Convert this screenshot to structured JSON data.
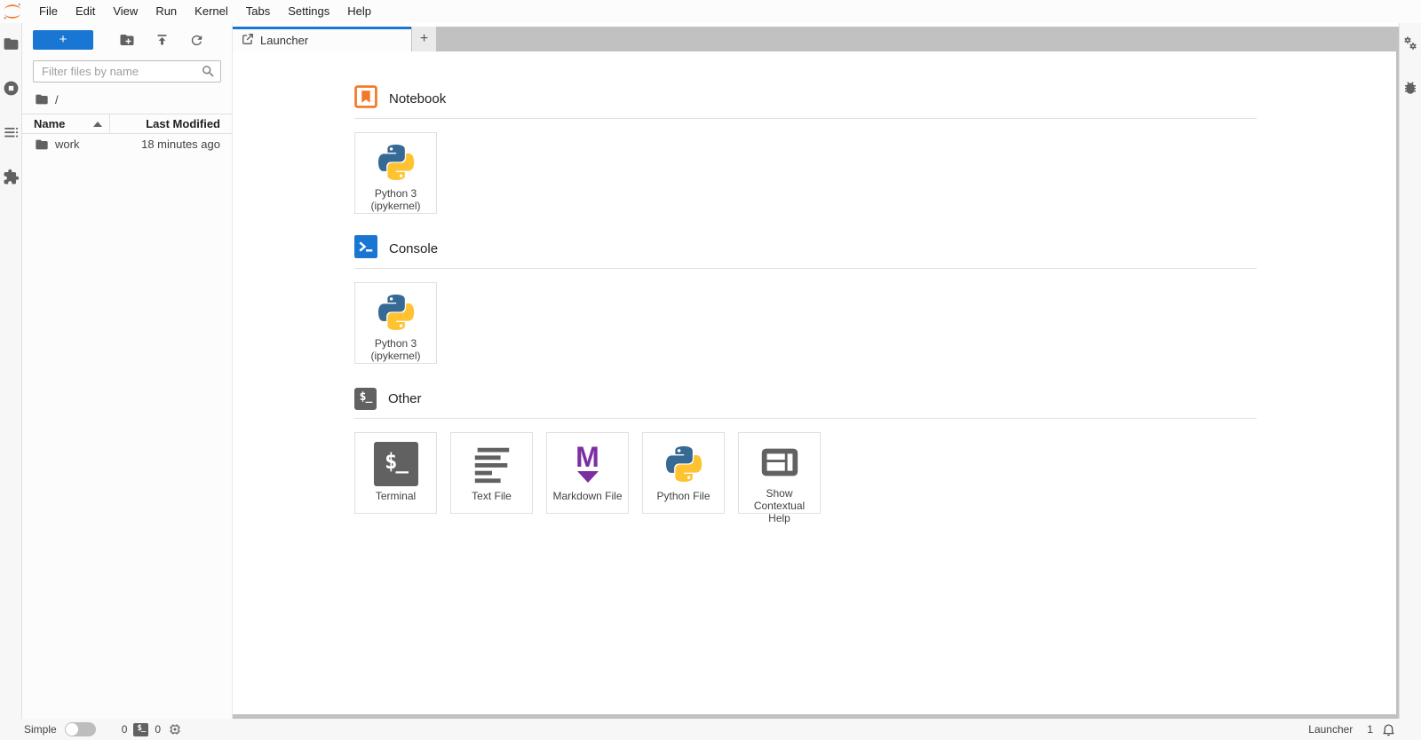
{
  "menu_bar": {
    "items": [
      "File",
      "Edit",
      "View",
      "Run",
      "Kernel",
      "Tabs",
      "Settings",
      "Help"
    ]
  },
  "left_sidebar": {
    "icons": [
      "file-browser",
      "running-terminals-and-kernels",
      "table-of-contents",
      "extension-manager"
    ]
  },
  "right_sidebar": {
    "icons": [
      "property-inspector",
      "debugger"
    ]
  },
  "file_browser": {
    "filter_placeholder": "Filter files by name",
    "breadcrumb_root": "/",
    "columns": [
      {
        "label": "Name"
      },
      {
        "label": "Last Modified"
      }
    ],
    "rows": [
      {
        "name": "work",
        "type": "folder",
        "last_modified": "18 minutes ago"
      }
    ]
  },
  "tab_bar": {
    "tabs": [
      {
        "label": "Launcher",
        "active": true
      }
    ]
  },
  "launcher": {
    "sections": [
      {
        "title": "Notebook",
        "icon": "notebook-icon",
        "cards": [
          {
            "label": "Python 3 (ipykernel)",
            "icon": "python-icon"
          }
        ]
      },
      {
        "title": "Console",
        "icon": "console-icon",
        "cards": [
          {
            "label": "Python 3 (ipykernel)",
            "icon": "python-icon"
          }
        ]
      },
      {
        "title": "Other",
        "icon": "terminal-icon",
        "cards": [
          {
            "label": "Terminal",
            "icon": "terminal-icon"
          },
          {
            "label": "Text File",
            "icon": "text-file-icon"
          },
          {
            "label": "Markdown File",
            "icon": "markdown-icon"
          },
          {
            "label": "Python File",
            "icon": "python-icon"
          },
          {
            "label": "Show Contextual Help",
            "icon": "contextual-help-icon"
          }
        ]
      }
    ]
  },
  "status_bar": {
    "mode_label": "Simple",
    "terminals_count": "0",
    "kernels_count": "0",
    "activity_label": "Launcher",
    "notifications_count": "1"
  },
  "glyphs": {
    "plus": "+",
    "terminal": "$_",
    "markdown_m": "M"
  },
  "colors": {
    "accent_blue": "#1976d2",
    "jupyter_orange": "#f37726",
    "markdown_purple": "#7b2fa0",
    "icon_gray": "#616161",
    "tab_bar_gray": "#c1c1c1"
  }
}
